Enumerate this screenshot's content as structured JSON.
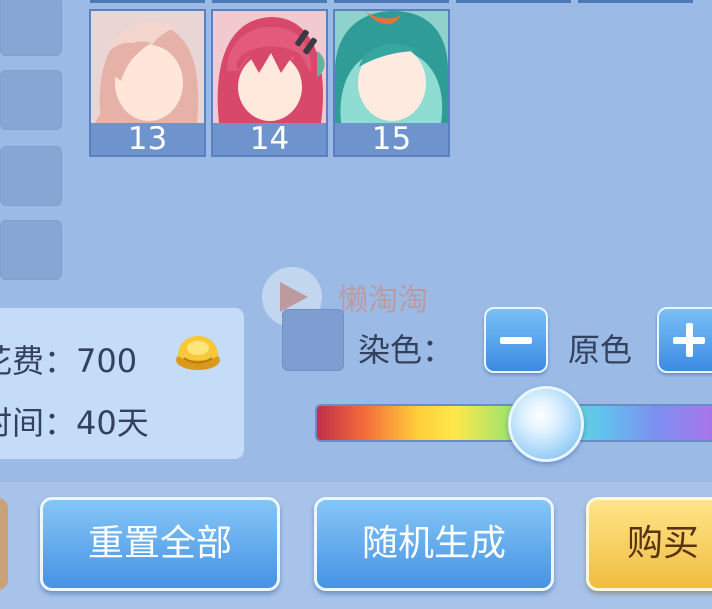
{
  "hair_styles": [
    {
      "number": "13",
      "hair_color": "#eab0a6",
      "accent": "#d9a59d"
    },
    {
      "number": "14",
      "hair_color": "#d8486a",
      "accent": "#b93656"
    },
    {
      "number": "15",
      "hair_color": "#36a7a0",
      "accent": "#e8733a"
    }
  ],
  "cost": {
    "fee_label": "花费：",
    "fee_value": "700",
    "time_label": "时间：",
    "time_value": "40天",
    "currency_icon": "gold-ingot-icon"
  },
  "dye": {
    "label": "染色：",
    "original_label": "原色",
    "minus_icon": "minus-icon",
    "plus_icon": "plus-icon",
    "slider_level": 0.55
  },
  "buttons": {
    "reset_all": "重置全部",
    "random_generate": "随机生成",
    "buy": "购买"
  },
  "watermark_text": "懒淘淘",
  "colors": {
    "background": "#9bbbe6",
    "button_blue": "#4693e5",
    "buy_gold": "#f0bd3f"
  }
}
